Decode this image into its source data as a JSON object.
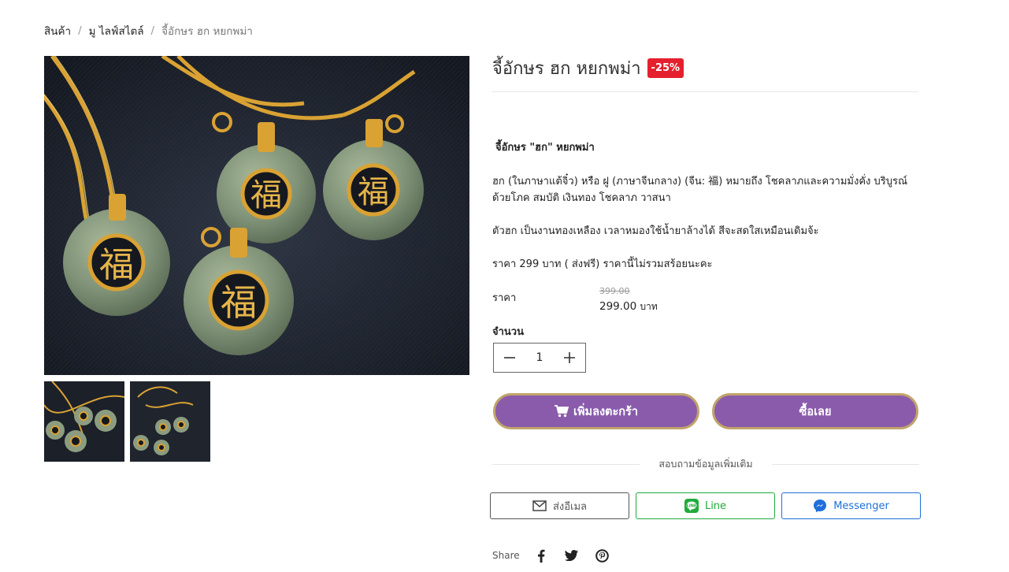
{
  "breadcrumb": {
    "items": [
      "สินค้า",
      "มู ไลฟ์สไตล์"
    ],
    "current": "จี้อักษร ฮก หยกพม่า",
    "separator": "/"
  },
  "product": {
    "title": "จี้อักษร ฮก หยกพม่า",
    "discount_badge": "-25%",
    "description": {
      "heading": "จี้อักษร \"ฮก\" หยกพม่า",
      "paragraph1": "ฮก (ในภาษาแต้จิ๋ว) หรือ ฝู (ภาษาจีนกลาง) (จีน: 福) หมายถึง โชคลาภและความมั่งคั่ง บริบูรณ์ด้วยโภค สมบัติ เงินทอง โชคลาภ วาสนา",
      "paragraph2": "ตัวฮก เป็นงานทองเหลือง เวลาหมองใช้น้ำยาล้างได้ สีจะสดใสเหมือนเดิมจ้ะ",
      "paragraph3": "ราคา 299 บาท ( ส่งฟรี) ราคานี้ไม่รวมสร้อยนะคะ"
    },
    "price_label": "ราคา",
    "original_price": "399.00",
    "sale_price": "299.00",
    "currency": "บาท",
    "quantity_label": "จำนวน",
    "quantity": "1"
  },
  "actions": {
    "add_to_cart": "เพิ่มลงตะกร้า",
    "buy_now": "ซื้อเลย"
  },
  "inquiry": {
    "title": "สอบถามข้อมูลเพิ่มเติม",
    "email_label": "ส่งอีเมล",
    "line_label": "Line",
    "messenger_label": "Messenger"
  },
  "share": {
    "label": "Share",
    "icons": [
      "facebook-icon",
      "twitter-icon",
      "pinterest-icon"
    ]
  },
  "colors": {
    "button_purple": "#8a5bab",
    "button_border_gold": "#c1a46a",
    "badge_red": "#e5202e",
    "line_green": "#1fab3a",
    "messenger_blue": "#1e6fd9"
  }
}
